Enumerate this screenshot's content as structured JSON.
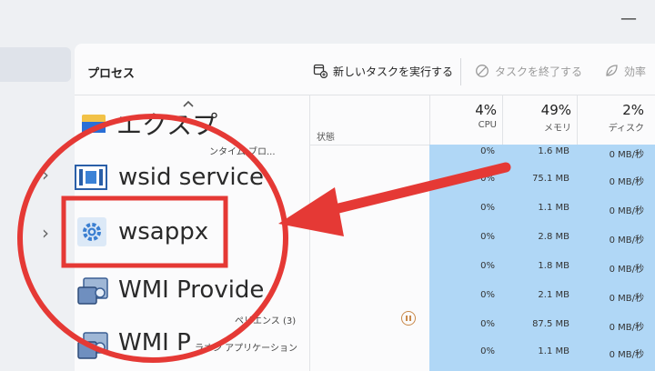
{
  "toolbar": {
    "title": "プロセス",
    "new_task": "新しいタスクを実行する",
    "end_task": "タスクを終了する",
    "efficiency": "効率"
  },
  "columns": {
    "status": "状態",
    "cpu": {
      "pct": "4%",
      "label": "CPU"
    },
    "memory": {
      "pct": "49%",
      "label": "メモリ"
    },
    "disk": {
      "pct": "2%",
      "label": "ディスク"
    }
  },
  "processes": {
    "explorer_partial": "エクスプ",
    "runtime_partial": "ンタイム ブロ...",
    "wsid": "wsid service",
    "wsappx": "wsappx",
    "wmi1": "WMI Provide",
    "experience_partial": "ペリエンス (3)",
    "wmi2": "WMI P",
    "app_partial": "ラオン アプリケーション"
  },
  "rows": [
    {
      "cpu": "0%",
      "mem": "1.6 MB",
      "disk": "0 MB/秒"
    },
    {
      "cpu": "0%",
      "mem": "75.1 MB",
      "disk": "0 MB/秒"
    },
    {
      "cpu": "0%",
      "mem": "1.1 MB",
      "disk": "0 MB/秒"
    },
    {
      "cpu": "0%",
      "mem": "2.8 MB",
      "disk": "0 MB/秒"
    },
    {
      "cpu": "0%",
      "mem": "1.8 MB",
      "disk": "0 MB/秒"
    },
    {
      "cpu": "0%",
      "mem": "2.1 MB",
      "disk": "0 MB/秒"
    },
    {
      "cpu": "0%",
      "mem": "87.5 MB",
      "disk": "0 MB/秒"
    },
    {
      "cpu": "0%",
      "mem": "1.1 MB",
      "disk": "0 MB/秒"
    }
  ],
  "colors": {
    "highlight": "#e53935",
    "cpu_band": "#b0d7f6"
  }
}
